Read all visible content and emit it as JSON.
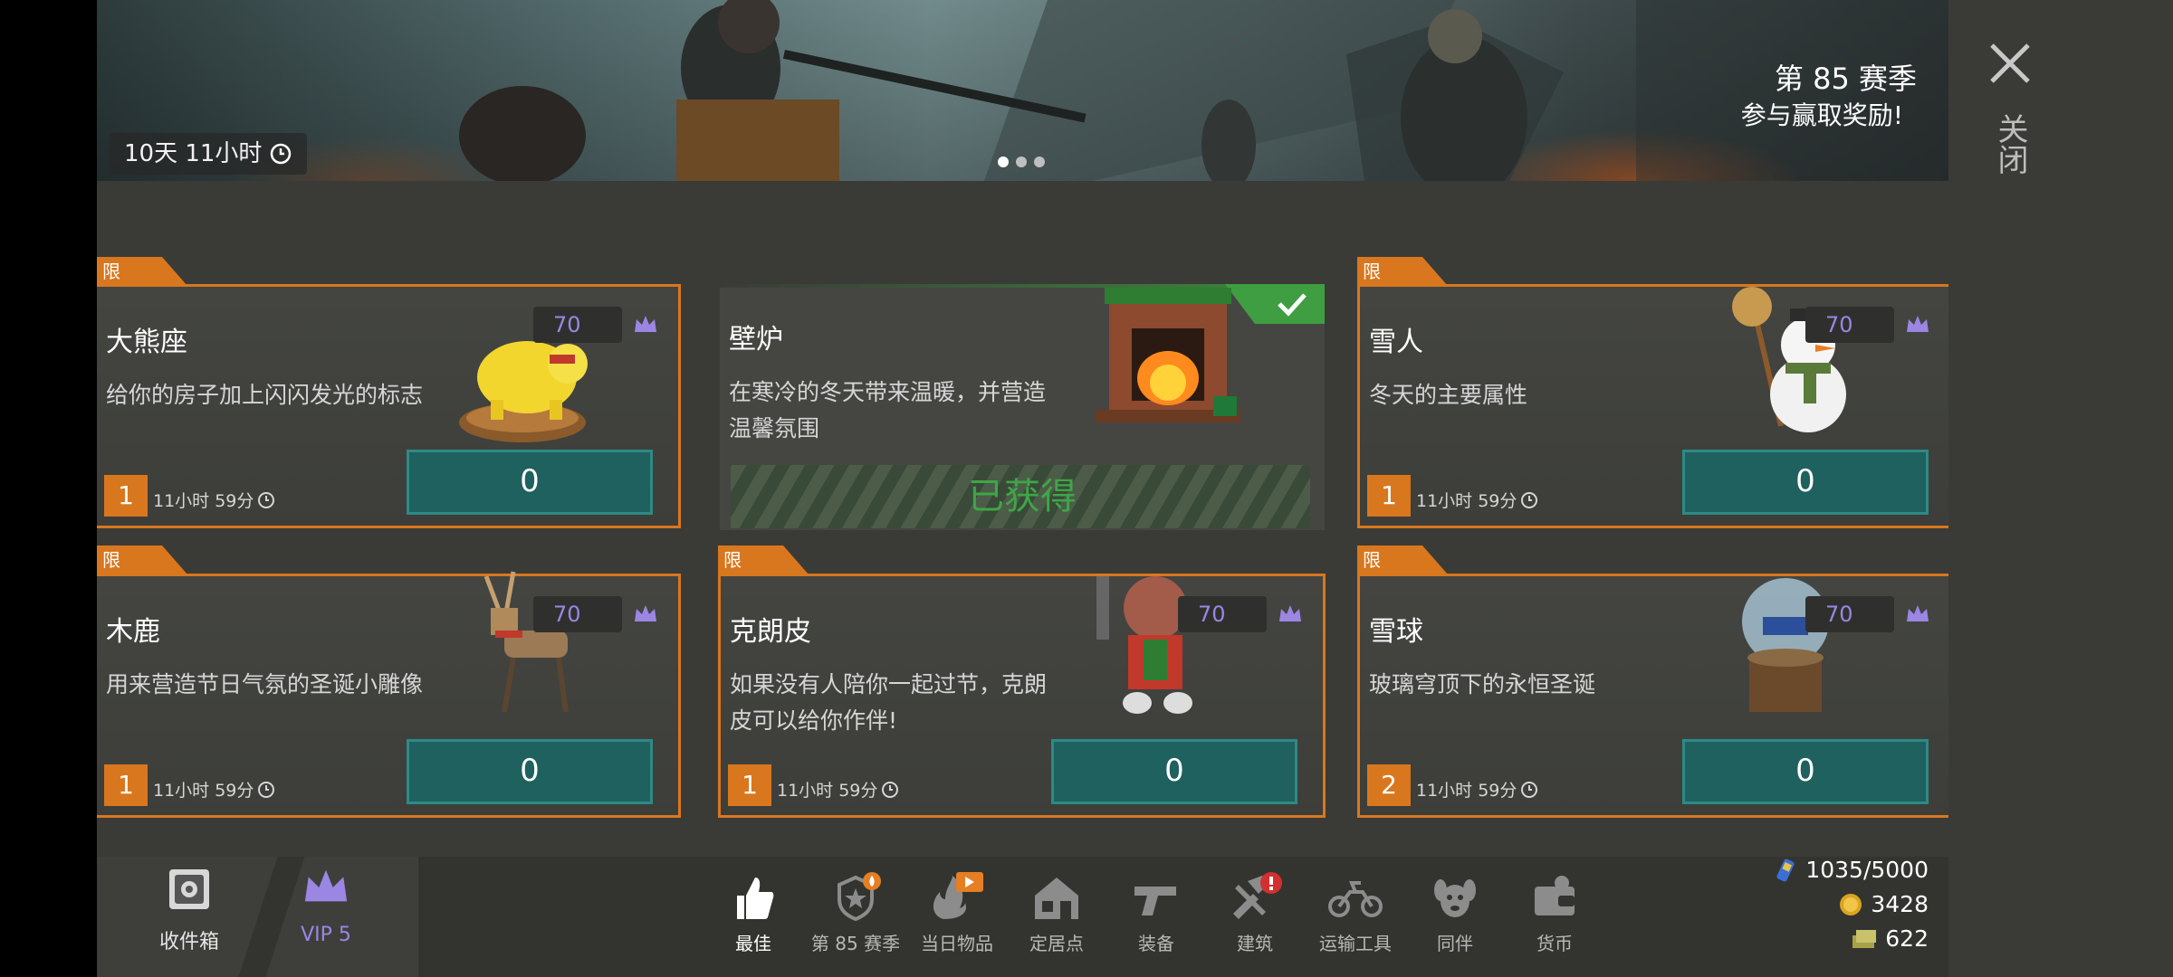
{
  "banner": {
    "timer": "10天 11小时",
    "season_title": "第 85 赛季",
    "season_subtitle": "参与赢取奖励!",
    "page_dots": 3,
    "active_dot": 0
  },
  "close_label": "关闭",
  "tag_label": "限量",
  "cards": [
    {
      "title": "大熊座",
      "desc": "给你的房子加上闪闪发光的标志",
      "price": "70",
      "qty": "1",
      "time": "11小时 59分",
      "button": "0",
      "owned": false
    },
    {
      "title": "壁炉",
      "desc": "在寒冷的冬天带来温暖，并营造温馨氛围",
      "owned": true,
      "owned_label": "已获得"
    },
    {
      "title": "雪人",
      "desc": "冬天的主要属性",
      "price": "70",
      "qty": "1",
      "time": "11小时 59分",
      "button": "0",
      "owned": false
    },
    {
      "title": "木鹿",
      "desc": "用来营造节日气氛的圣诞小雕像",
      "price": "70",
      "qty": "1",
      "time": "11小时 59分",
      "button": "0",
      "owned": false
    },
    {
      "title": "克朗皮",
      "desc": "如果没有人陪你一起过节，克朗皮可以给你作伴!",
      "price": "70",
      "qty": "1",
      "time": "11小时 59分",
      "button": "0",
      "owned": false
    },
    {
      "title": "雪球",
      "desc": "玻璃穹顶下的永恒圣诞",
      "price": "70",
      "qty": "2",
      "time": "11小时 59分",
      "button": "0",
      "owned": false
    }
  ],
  "bottom_left": {
    "inbox": "收件箱",
    "vip": "VIP 5"
  },
  "nav": [
    {
      "label": "最佳",
      "icon": "thumbs-up-icon",
      "active": true
    },
    {
      "label": "第 85 赛季",
      "icon": "season-badge-icon",
      "badge": "fire"
    },
    {
      "label": "当日物品",
      "icon": "flame-icon",
      "badge": "play"
    },
    {
      "label": "定居点",
      "icon": "house-icon"
    },
    {
      "label": "装备",
      "icon": "pistol-icon"
    },
    {
      "label": "建筑",
      "icon": "hammer-icon",
      "badge": "alert"
    },
    {
      "label": "运输工具",
      "icon": "motorcycle-icon"
    },
    {
      "label": "同伴",
      "icon": "dog-icon"
    },
    {
      "label": "货币",
      "icon": "wallet-icon"
    }
  ],
  "resources": {
    "energy": "1035/5000",
    "coins": "3428",
    "cash": "622"
  },
  "colors": {
    "accent": "#d9771e",
    "button": "#1e615e",
    "premium": "#9b86e3",
    "owned": "#3ea647"
  }
}
